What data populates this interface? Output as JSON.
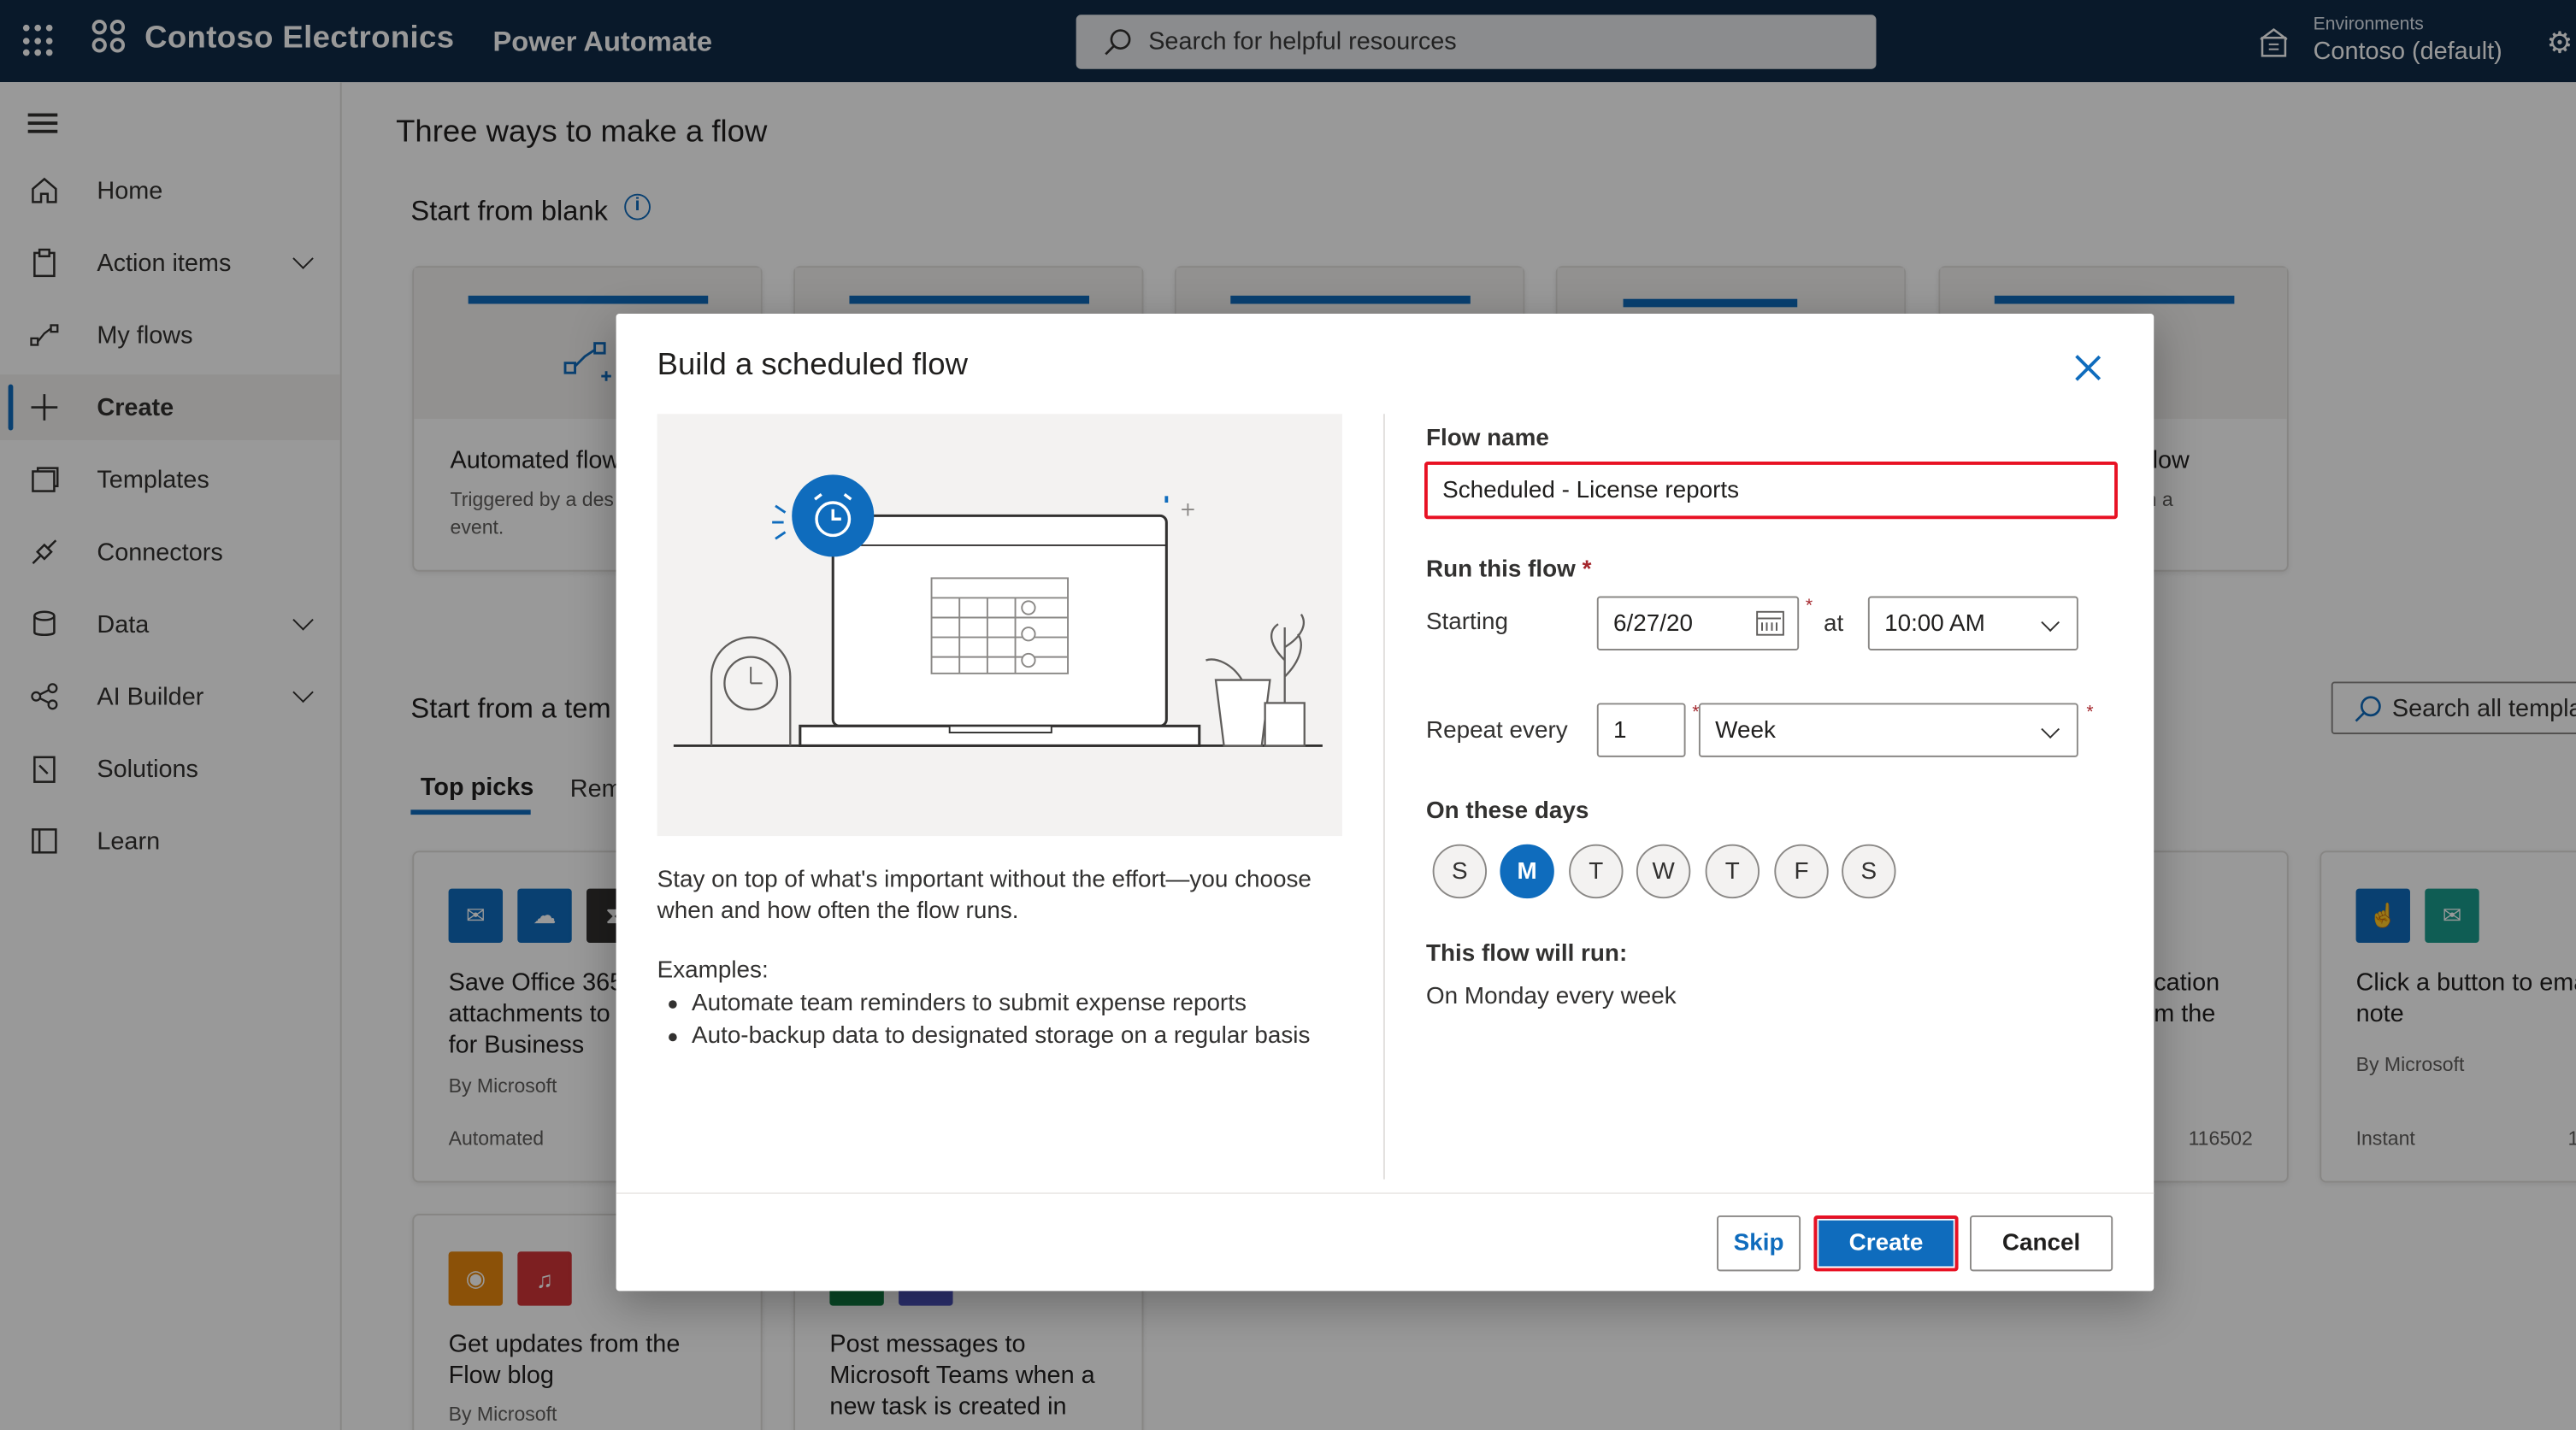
{
  "topbar": {
    "brand": "Contoso Electronics",
    "app": "Power Automate",
    "search_placeholder": "Search for helpful resources",
    "env_label": "Environments",
    "env_value": "Contoso (default)"
  },
  "nav": {
    "items": [
      {
        "label": "Home",
        "icon": "home-icon"
      },
      {
        "label": "Action items",
        "icon": "clipboard-icon",
        "expandable": true
      },
      {
        "label": "My flows",
        "icon": "flow-icon"
      },
      {
        "label": "Create",
        "icon": "plus-icon",
        "active": true
      },
      {
        "label": "Templates",
        "icon": "templates-icon"
      },
      {
        "label": "Connectors",
        "icon": "connector-icon"
      },
      {
        "label": "Data",
        "icon": "database-icon",
        "expandable": true
      },
      {
        "label": "AI Builder",
        "icon": "ai-icon",
        "expandable": true
      },
      {
        "label": "Solutions",
        "icon": "solutions-icon"
      },
      {
        "label": "Learn",
        "icon": "book-icon"
      }
    ]
  },
  "main": {
    "title": "Three ways to make a flow",
    "blank_section": "Start from blank",
    "template_section": "Start from a tem",
    "blank_card": {
      "title": "Automated flow",
      "sub1": "Triggered by a des",
      "sub2": "event."
    },
    "right_card": {
      "title": "flow",
      "sub": "h a"
    },
    "tabs": [
      "Top picks",
      "Rem"
    ],
    "search_templates": "Search all templa",
    "templates": [
      {
        "title1": "Save Office 365",
        "title2": "attachments to",
        "title3": "for Business",
        "by": "By Microsoft",
        "type": "Automated"
      },
      {
        "title1": "cation",
        "title2": "m the",
        "count": "116502"
      },
      {
        "title1": "Click a button to ema",
        "title2": "note",
        "by": "By Microsoft",
        "type": "Instant",
        "count": "1"
      },
      {
        "title1": "Get updates from the",
        "title2": "Flow blog",
        "by": "By Microsoft"
      },
      {
        "title1": "Post messages to",
        "title2": "Microsoft Teams when a",
        "title3": "new task is created in"
      }
    ]
  },
  "dialog": {
    "title": "Build a scheduled flow",
    "description": "Stay on top of what's important without the effort—you choose when and how often the flow runs.",
    "examples_heading": "Examples:",
    "examples": [
      "Automate team reminders to submit expense reports",
      "Auto-backup data to designated storage on a regular basis"
    ],
    "flow_name_label": "Flow name",
    "flow_name_value": "Scheduled - License reports",
    "run_label": "Run this flow",
    "required_mark": "*",
    "starting_label": "Starting",
    "start_date": "6/27/20",
    "at_label": "at",
    "start_time": "10:00 AM",
    "repeat_label": "Repeat every",
    "repeat_count": "1",
    "repeat_unit": "Week",
    "days_label": "On these days",
    "days": [
      {
        "letter": "S",
        "selected": false
      },
      {
        "letter": "M",
        "selected": true
      },
      {
        "letter": "T",
        "selected": false
      },
      {
        "letter": "W",
        "selected": false
      },
      {
        "letter": "T",
        "selected": false
      },
      {
        "letter": "F",
        "selected": false
      },
      {
        "letter": "S",
        "selected": false
      }
    ],
    "will_run_label": "This flow will run:",
    "will_run_value": "On Monday every week",
    "buttons": {
      "skip": "Skip",
      "create": "Create",
      "cancel": "Cancel"
    }
  },
  "colors": {
    "topbar": "#0f2a47",
    "accent": "#0f6cbd",
    "highlight": "#e81123"
  }
}
